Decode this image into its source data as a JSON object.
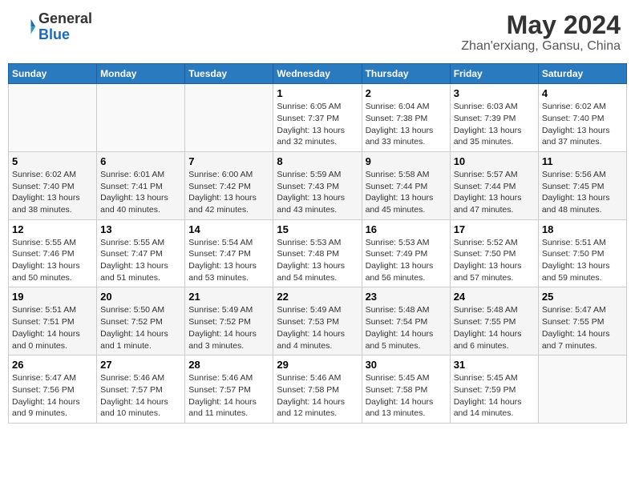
{
  "header": {
    "logo_line1": "General",
    "logo_line2": "Blue",
    "month": "May 2024",
    "location": "Zhan'erxiang, Gansu, China"
  },
  "weekdays": [
    "Sunday",
    "Monday",
    "Tuesday",
    "Wednesday",
    "Thursday",
    "Friday",
    "Saturday"
  ],
  "weeks": [
    [
      {
        "day": "",
        "info": ""
      },
      {
        "day": "",
        "info": ""
      },
      {
        "day": "",
        "info": ""
      },
      {
        "day": "1",
        "info": "Sunrise: 6:05 AM\nSunset: 7:37 PM\nDaylight: 13 hours\nand 32 minutes."
      },
      {
        "day": "2",
        "info": "Sunrise: 6:04 AM\nSunset: 7:38 PM\nDaylight: 13 hours\nand 33 minutes."
      },
      {
        "day": "3",
        "info": "Sunrise: 6:03 AM\nSunset: 7:39 PM\nDaylight: 13 hours\nand 35 minutes."
      },
      {
        "day": "4",
        "info": "Sunrise: 6:02 AM\nSunset: 7:40 PM\nDaylight: 13 hours\nand 37 minutes."
      }
    ],
    [
      {
        "day": "5",
        "info": "Sunrise: 6:02 AM\nSunset: 7:40 PM\nDaylight: 13 hours\nand 38 minutes."
      },
      {
        "day": "6",
        "info": "Sunrise: 6:01 AM\nSunset: 7:41 PM\nDaylight: 13 hours\nand 40 minutes."
      },
      {
        "day": "7",
        "info": "Sunrise: 6:00 AM\nSunset: 7:42 PM\nDaylight: 13 hours\nand 42 minutes."
      },
      {
        "day": "8",
        "info": "Sunrise: 5:59 AM\nSunset: 7:43 PM\nDaylight: 13 hours\nand 43 minutes."
      },
      {
        "day": "9",
        "info": "Sunrise: 5:58 AM\nSunset: 7:44 PM\nDaylight: 13 hours\nand 45 minutes."
      },
      {
        "day": "10",
        "info": "Sunrise: 5:57 AM\nSunset: 7:44 PM\nDaylight: 13 hours\nand 47 minutes."
      },
      {
        "day": "11",
        "info": "Sunrise: 5:56 AM\nSunset: 7:45 PM\nDaylight: 13 hours\nand 48 minutes."
      }
    ],
    [
      {
        "day": "12",
        "info": "Sunrise: 5:55 AM\nSunset: 7:46 PM\nDaylight: 13 hours\nand 50 minutes."
      },
      {
        "day": "13",
        "info": "Sunrise: 5:55 AM\nSunset: 7:47 PM\nDaylight: 13 hours\nand 51 minutes."
      },
      {
        "day": "14",
        "info": "Sunrise: 5:54 AM\nSunset: 7:47 PM\nDaylight: 13 hours\nand 53 minutes."
      },
      {
        "day": "15",
        "info": "Sunrise: 5:53 AM\nSunset: 7:48 PM\nDaylight: 13 hours\nand 54 minutes."
      },
      {
        "day": "16",
        "info": "Sunrise: 5:53 AM\nSunset: 7:49 PM\nDaylight: 13 hours\nand 56 minutes."
      },
      {
        "day": "17",
        "info": "Sunrise: 5:52 AM\nSunset: 7:50 PM\nDaylight: 13 hours\nand 57 minutes."
      },
      {
        "day": "18",
        "info": "Sunrise: 5:51 AM\nSunset: 7:50 PM\nDaylight: 13 hours\nand 59 minutes."
      }
    ],
    [
      {
        "day": "19",
        "info": "Sunrise: 5:51 AM\nSunset: 7:51 PM\nDaylight: 14 hours\nand 0 minutes."
      },
      {
        "day": "20",
        "info": "Sunrise: 5:50 AM\nSunset: 7:52 PM\nDaylight: 14 hours\nand 1 minute."
      },
      {
        "day": "21",
        "info": "Sunrise: 5:49 AM\nSunset: 7:52 PM\nDaylight: 14 hours\nand 3 minutes."
      },
      {
        "day": "22",
        "info": "Sunrise: 5:49 AM\nSunset: 7:53 PM\nDaylight: 14 hours\nand 4 minutes."
      },
      {
        "day": "23",
        "info": "Sunrise: 5:48 AM\nSunset: 7:54 PM\nDaylight: 14 hours\nand 5 minutes."
      },
      {
        "day": "24",
        "info": "Sunrise: 5:48 AM\nSunset: 7:55 PM\nDaylight: 14 hours\nand 6 minutes."
      },
      {
        "day": "25",
        "info": "Sunrise: 5:47 AM\nSunset: 7:55 PM\nDaylight: 14 hours\nand 7 minutes."
      }
    ],
    [
      {
        "day": "26",
        "info": "Sunrise: 5:47 AM\nSunset: 7:56 PM\nDaylight: 14 hours\nand 9 minutes."
      },
      {
        "day": "27",
        "info": "Sunrise: 5:46 AM\nSunset: 7:57 PM\nDaylight: 14 hours\nand 10 minutes."
      },
      {
        "day": "28",
        "info": "Sunrise: 5:46 AM\nSunset: 7:57 PM\nDaylight: 14 hours\nand 11 minutes."
      },
      {
        "day": "29",
        "info": "Sunrise: 5:46 AM\nSunset: 7:58 PM\nDaylight: 14 hours\nand 12 minutes."
      },
      {
        "day": "30",
        "info": "Sunrise: 5:45 AM\nSunset: 7:58 PM\nDaylight: 14 hours\nand 13 minutes."
      },
      {
        "day": "31",
        "info": "Sunrise: 5:45 AM\nSunset: 7:59 PM\nDaylight: 14 hours\nand 14 minutes."
      },
      {
        "day": "",
        "info": ""
      }
    ]
  ]
}
